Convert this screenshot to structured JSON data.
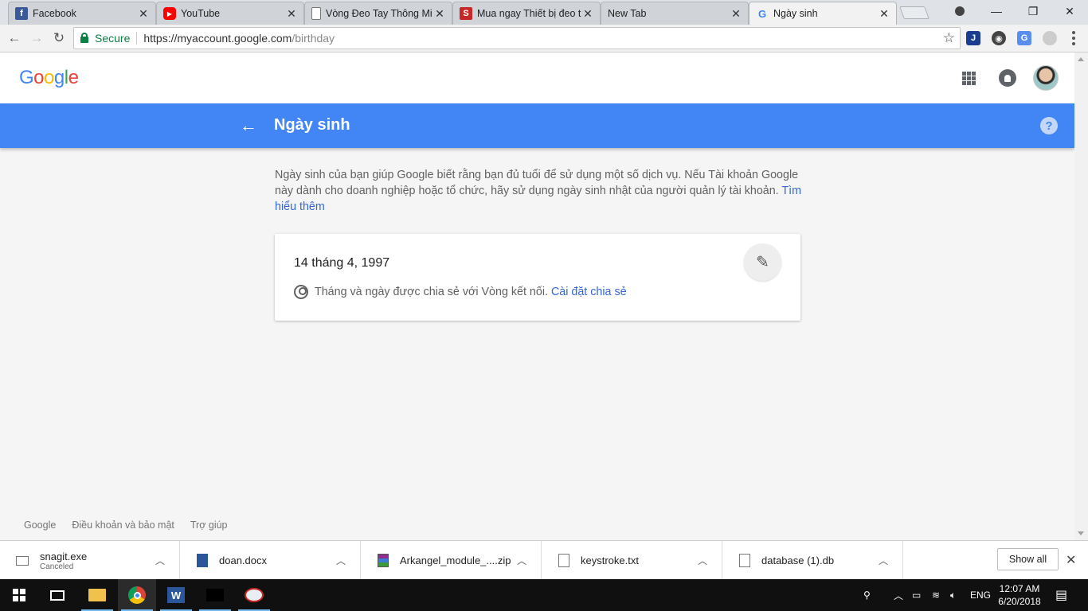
{
  "browser": {
    "tabs": [
      {
        "title": "Facebook",
        "icon": "facebook-icon",
        "color": "#3b5998"
      },
      {
        "title": "YouTube",
        "icon": "youtube-icon",
        "color": "#ff0000"
      },
      {
        "title": "Vòng Đeo Tay Thông Mi",
        "icon": "document-icon",
        "color": "#777777"
      },
      {
        "title": "Mua ngay Thiết bị đeo t",
        "icon": "s-brand-icon",
        "color": "#c62828"
      },
      {
        "title": "New Tab",
        "icon": "",
        "color": ""
      },
      {
        "title": "Ngày sinh",
        "icon": "google-g-icon",
        "color": "#4285f4"
      }
    ],
    "address": {
      "secure_label": "Secure",
      "url_host": "https://myaccount.google.com",
      "url_path": "/birthday"
    }
  },
  "header": {
    "logo": "Google"
  },
  "bluebar": {
    "title": "Ngày sinh",
    "help": "?"
  },
  "content": {
    "description": "Ngày sinh của bạn giúp Google biết rằng bạn đủ tuổi để sử dụng một số dịch vụ. Nếu Tài khoản Google này dành cho doanh nghiệp hoặc tổ chức, hãy sử dụng ngày sinh nhật của người quản lý tài khoản.",
    "learn_more": "Tìm hiểu thêm",
    "birthday": "14 tháng 4, 1997",
    "share_text": "Tháng và ngày được chia sẻ với Vòng kết nối.",
    "share_link": "Cài đặt chia sẻ"
  },
  "footer": {
    "links": [
      "Google",
      "Điều khoản và bảo mật",
      "Trợ giúp"
    ]
  },
  "downloads": {
    "items": [
      {
        "name": "snagit.exe",
        "status": "Canceled"
      },
      {
        "name": "doan.docx",
        "status": ""
      },
      {
        "name": "Arkangel_module_....zip",
        "status": ""
      },
      {
        "name": "keystroke.txt",
        "status": ""
      },
      {
        "name": "database (1).db",
        "status": ""
      }
    ],
    "show_all": "Show all"
  },
  "taskbar": {
    "language": "ENG",
    "time": "12:07 AM",
    "date": "6/20/2018"
  },
  "colors": {
    "accent_blue": "#4285f4",
    "link": "#3367d6",
    "secure_green": "#0b8043"
  }
}
